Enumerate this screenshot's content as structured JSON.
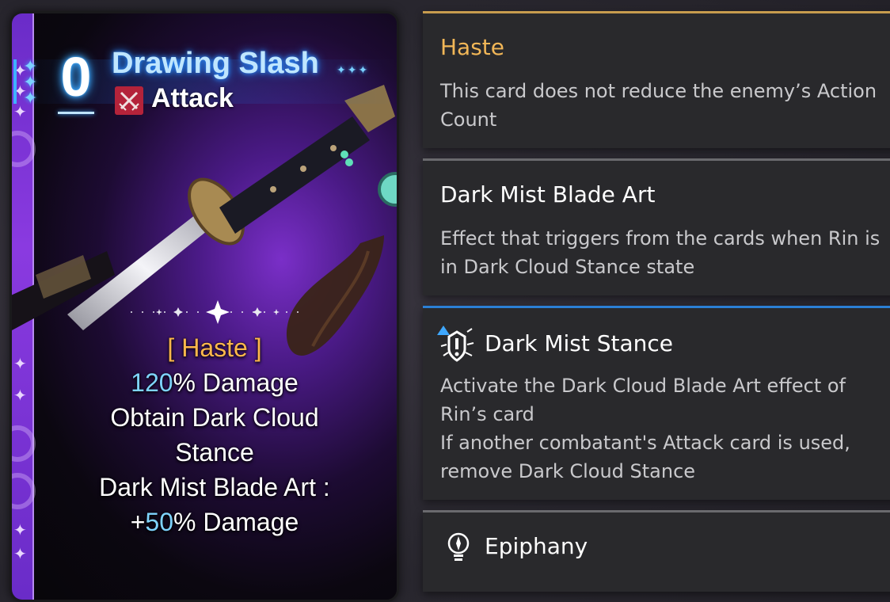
{
  "card": {
    "cost": "0",
    "name": "Drawing Slash",
    "type": "Attack",
    "keyword": "[ Haste ]",
    "line2_num": "120",
    "line2_rest": "% Damage",
    "line3": "Obtain Dark Cloud",
    "line4": "Stance",
    "line5": "Dark Mist Blade Art :",
    "line6_prefix": "+",
    "line6_num": "50",
    "line6_rest": "% Damage"
  },
  "panels": [
    {
      "title": "Haste",
      "desc": "This card does not reduce the enemy’s Action Count"
    },
    {
      "title": "Dark Mist Blade Art",
      "desc": "Effect that triggers from the cards when Rin is in Dark Cloud Stance state"
    },
    {
      "title": "Dark Mist Stance",
      "desc1": "Activate the Dark Cloud Blade Art effect of Rin’s card",
      "desc2": "If another combatant's Attack card is used, remove Dark Cloud Stance"
    },
    {
      "title": "Epiphany"
    }
  ],
  "colors": {
    "keyword": "#ffb84c",
    "number": "#7fd4ff",
    "name_glow": "#2a8cff",
    "haste_title": "#f1b657",
    "panel_bg": "#29292c"
  },
  "icons": [
    "attack-type-icon",
    "stance-icon",
    "epiphany-icon",
    "card-sparkle-icon"
  ]
}
